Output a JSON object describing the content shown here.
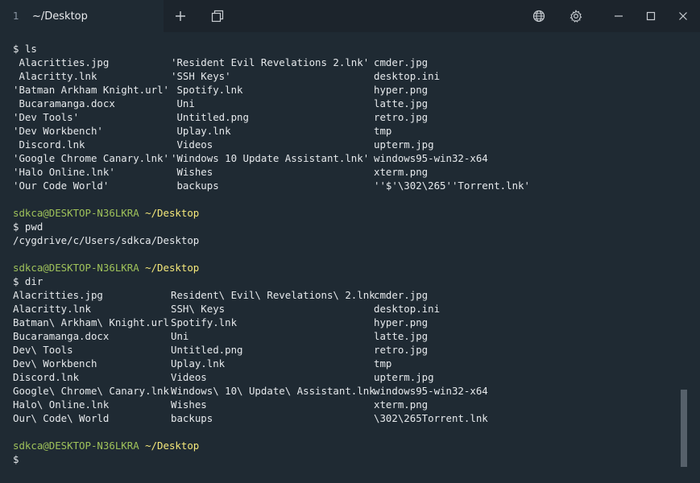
{
  "titlebar": {
    "tab_index": "1",
    "tab_title": "~/Desktop",
    "new_tab_symbol": "+",
    "icons": [
      "plus-icon",
      "split-pane-icon",
      "globe-icon",
      "gear-icon",
      "minimize-icon",
      "maximize-icon",
      "close-icon"
    ]
  },
  "colors": {
    "background": "#1f2a33",
    "titlebar": "#1c242c",
    "user_host": "#9fc25a",
    "path": "#f5e87a",
    "text": "#e6e9ec"
  },
  "terminal": {
    "block1": {
      "command": "$ ls",
      "rows": [
        [
          " Alacritties.jpg",
          "'Resident Evil Revelations 2.lnk'",
          "cmder.jpg"
        ],
        [
          " Alacritty.lnk",
          "'SSH Keys'",
          "desktop.ini"
        ],
        [
          "'Batman Arkham Knight.url'",
          " Spotify.lnk",
          "hyper.png"
        ],
        [
          " Bucaramanga.docx",
          " Uni",
          "latte.jpg"
        ],
        [
          "'Dev Tools'",
          " Untitled.png",
          "retro.jpg"
        ],
        [
          "'Dev Workbench'",
          " Uplay.lnk",
          "tmp"
        ],
        [
          " Discord.lnk",
          " Videos",
          "upterm.jpg"
        ],
        [
          "'Google Chrome Canary.lnk'",
          "'Windows 10 Update Assistant.lnk'",
          "windows95-win32-x64"
        ],
        [
          "'Halo Online.lnk'",
          " Wishes",
          "xterm.png"
        ],
        [
          "'Our Code World'",
          " backups",
          "''$'\\302\\265''Torrent.lnk'"
        ]
      ]
    },
    "prompt2": {
      "user": "sdkca@DESKTOP-N36LKRA",
      "path": "~/Desktop"
    },
    "block2": {
      "command": "$ pwd",
      "output": "/cygdrive/c/Users/sdkca/Desktop"
    },
    "prompt3": {
      "user": "sdkca@DESKTOP-N36LKRA",
      "path": "~/Desktop"
    },
    "block3": {
      "command": "$ dir",
      "rows": [
        [
          "Alacritties.jpg",
          "Resident\\ Evil\\ Revelations\\ 2.lnk",
          "cmder.jpg"
        ],
        [
          "Alacritty.lnk",
          "SSH\\ Keys",
          "desktop.ini"
        ],
        [
          "Batman\\ Arkham\\ Knight.url",
          "Spotify.lnk",
          "hyper.png"
        ],
        [
          "Bucaramanga.docx",
          "Uni",
          "latte.jpg"
        ],
        [
          "Dev\\ Tools",
          "Untitled.png",
          "retro.jpg"
        ],
        [
          "Dev\\ Workbench",
          "Uplay.lnk",
          "tmp"
        ],
        [
          "Discord.lnk",
          "Videos",
          "upterm.jpg"
        ],
        [
          "Google\\ Chrome\\ Canary.lnk",
          "Windows\\ 10\\ Update\\ Assistant.lnk",
          "windows95-win32-x64"
        ],
        [
          "Halo\\ Online.lnk",
          "Wishes",
          "xterm.png"
        ],
        [
          "Our\\ Code\\ World",
          "backups",
          "\\302\\265Torrent.lnk"
        ]
      ]
    },
    "prompt4": {
      "user": "sdkca@DESKTOP-N36LKRA",
      "path": "~/Desktop"
    },
    "current_prompt": "$"
  }
}
